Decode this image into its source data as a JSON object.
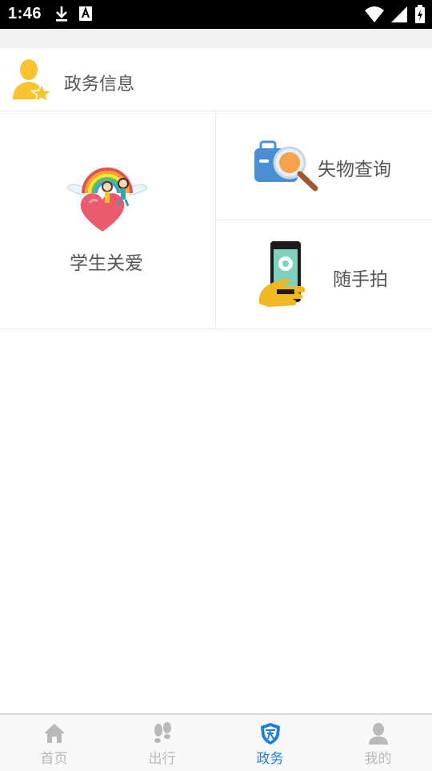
{
  "status_bar": {
    "time": "1:46",
    "left_icons": [
      "download-icon",
      "a-badge-icon"
    ],
    "right_icons": [
      "wifi-icon",
      "signal-icon",
      "battery-charging-icon"
    ]
  },
  "section": {
    "title": "政务信息",
    "icon": "user-star-icon",
    "icon_color": "#f7c32e"
  },
  "tiles": [
    {
      "label": "学生关爱",
      "icon": "rainbow-heart-kids-icon"
    },
    {
      "label": "失物查询",
      "icon": "suitcase-magnifier-icon"
    },
    {
      "label": "随手拍",
      "icon": "hand-phone-camera-icon"
    }
  ],
  "bottom_nav": {
    "items": [
      {
        "label": "首页",
        "icon": "home-icon",
        "active": false
      },
      {
        "label": "出行",
        "icon": "footprints-icon",
        "active": false
      },
      {
        "label": "政务",
        "icon": "shield-icon",
        "active": true
      },
      {
        "label": "我的",
        "icon": "person-icon",
        "active": false
      }
    ],
    "active_color": "#1f7fe0",
    "inactive_color": "#b9b9b9"
  }
}
